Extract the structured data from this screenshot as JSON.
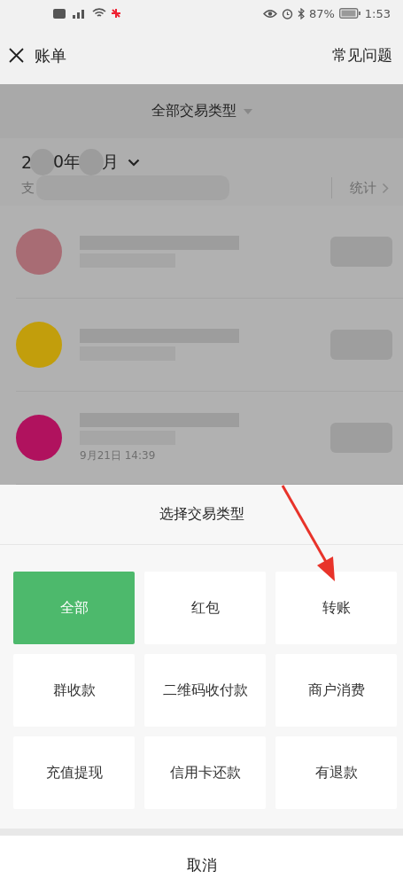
{
  "status_bar": {
    "battery": "87%",
    "time": "1:53"
  },
  "header": {
    "title": "账单",
    "help": "常见问题"
  },
  "filter": {
    "label": "全部交易类型"
  },
  "month": {
    "parts": [
      "2",
      "0年",
      "月"
    ],
    "expense_label": "支",
    "stats": "统计"
  },
  "transactions": [
    {
      "color": "#a86c74"
    },
    {
      "color": "#c29e0c"
    },
    {
      "color": "#b0125e",
      "time": "9月21日 14:39"
    }
  ],
  "sheet": {
    "title": "选择交易类型",
    "options": [
      {
        "label": "全部",
        "selected": true
      },
      {
        "label": "红包",
        "selected": false
      },
      {
        "label": "转账",
        "selected": false
      },
      {
        "label": "群收款",
        "selected": false
      },
      {
        "label": "二维码收付款",
        "selected": false
      },
      {
        "label": "商户消费",
        "selected": false
      },
      {
        "label": "充值提现",
        "selected": false
      },
      {
        "label": "信用卡还款",
        "selected": false
      },
      {
        "label": "有退款",
        "selected": false
      }
    ],
    "cancel": "取消"
  }
}
